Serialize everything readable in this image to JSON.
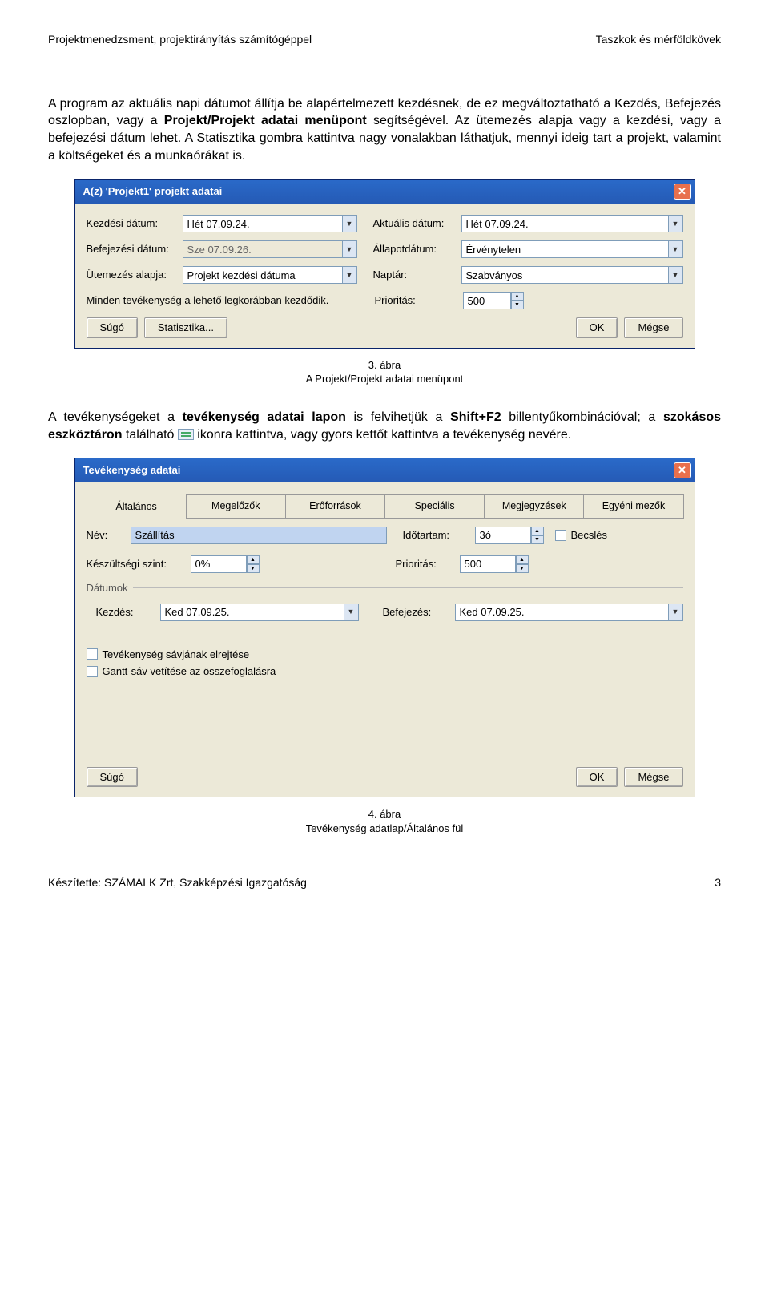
{
  "header": {
    "left": "Projektmenedzsment, projektirányítás számítógéppel",
    "right": "Taszkok és mérföldkövek"
  },
  "para1_full": "A program az aktuális napi dátumot állítja be alapértelmezett kezdésnek, de ez megváltoztatható a Kezdés, Befejezés oszlopban, vagy a Projekt/Projekt adatai menüpont segítségével. Az ütemezés alapja vagy a kezdési, vagy a befejezési dátum lehet. A Statisztika gombra kattintva nagy vonalakban láthatjuk, mennyi ideig tart a projekt, valamint a költségeket és a munkaórákat is.",
  "para1": {
    "pre": "A program az aktuális napi dátumot állítja be alapértelmezett kezdésnek, de ez megváltoztatható a Kezdés, Befejezés oszlopban, vagy a ",
    "b1": "Projekt/Projekt adatai menüpont",
    "post": " segítségével. Az ütemezés alapja vagy a kezdési, vagy a befejezési dátum lehet. A Statisztika gombra kattintva nagy vonalakban láthatjuk, mennyi ideig tart a projekt, valamint a költségeket és a munkaórákat is."
  },
  "dlg1": {
    "title": "A(z) 'Projekt1' projekt adatai",
    "labels": {
      "start": "Kezdési dátum:",
      "current": "Aktuális dátum:",
      "end": "Befejezési dátum:",
      "status": "Állapotdátum:",
      "sched": "Ütemezés alapja:",
      "cal": "Naptár:",
      "note": "Minden tevékenység a lehető legkorábban kezdődik.",
      "prio": "Prioritás:"
    },
    "values": {
      "start": "Hét 07.09.24.",
      "current": "Hét 07.09.24.",
      "end": "Sze 07.09.26.",
      "status": "Érvénytelen",
      "sched": "Projekt kezdési dátuma",
      "cal": "Szabványos",
      "prio": "500"
    },
    "buttons": {
      "help": "Súgó",
      "stats": "Statisztika...",
      "ok": "OK",
      "cancel": "Mégse"
    }
  },
  "caption1": {
    "num": "3. ábra",
    "txt": "A Projekt/Projekt adatai menüpont"
  },
  "para2": {
    "pre": "A tevékenységeket a ",
    "b1": "tevékenység adatai lapon",
    "mid1": " is felvihetjük a ",
    "b2": "Shift+F2",
    "mid2": " billentyűkombinációval; a ",
    "b3": "szokásos eszköztáron",
    "mid3": " található ",
    "post": " ikonra kattintva, vagy gyors kettőt kattintva a tevékenység nevére."
  },
  "dlg2": {
    "title": "Tevékenység adatai",
    "tabs": [
      "Általános",
      "Megelőzők",
      "Erőforrások",
      "Speciális",
      "Megjegyzések",
      "Egyéni mezők"
    ],
    "labels": {
      "name": "Név:",
      "dur": "Időtartam:",
      "est": "Becslés",
      "pct": "Készültségi szint:",
      "prio": "Prioritás:",
      "dates": "Dátumok",
      "start": "Kezdés:",
      "end": "Befejezés:",
      "hide": "Tevékenység sávjának elrejtése",
      "gantt": "Gantt-sáv vetítése az összefoglalásra"
    },
    "values": {
      "name": "Szállítás",
      "dur": "3ó",
      "pct": "0%",
      "prio": "500",
      "start": "Ked 07.09.25.",
      "end": "Ked 07.09.25."
    },
    "buttons": {
      "help": "Súgó",
      "ok": "OK",
      "cancel": "Mégse"
    }
  },
  "caption2": {
    "num": "4. ábra",
    "txt": "Tevékenység adatlap/Általános fül"
  },
  "footer": {
    "left": "Készítette: SZÁMALK Zrt, Szakképzési Igazgatóság",
    "right": "3"
  }
}
